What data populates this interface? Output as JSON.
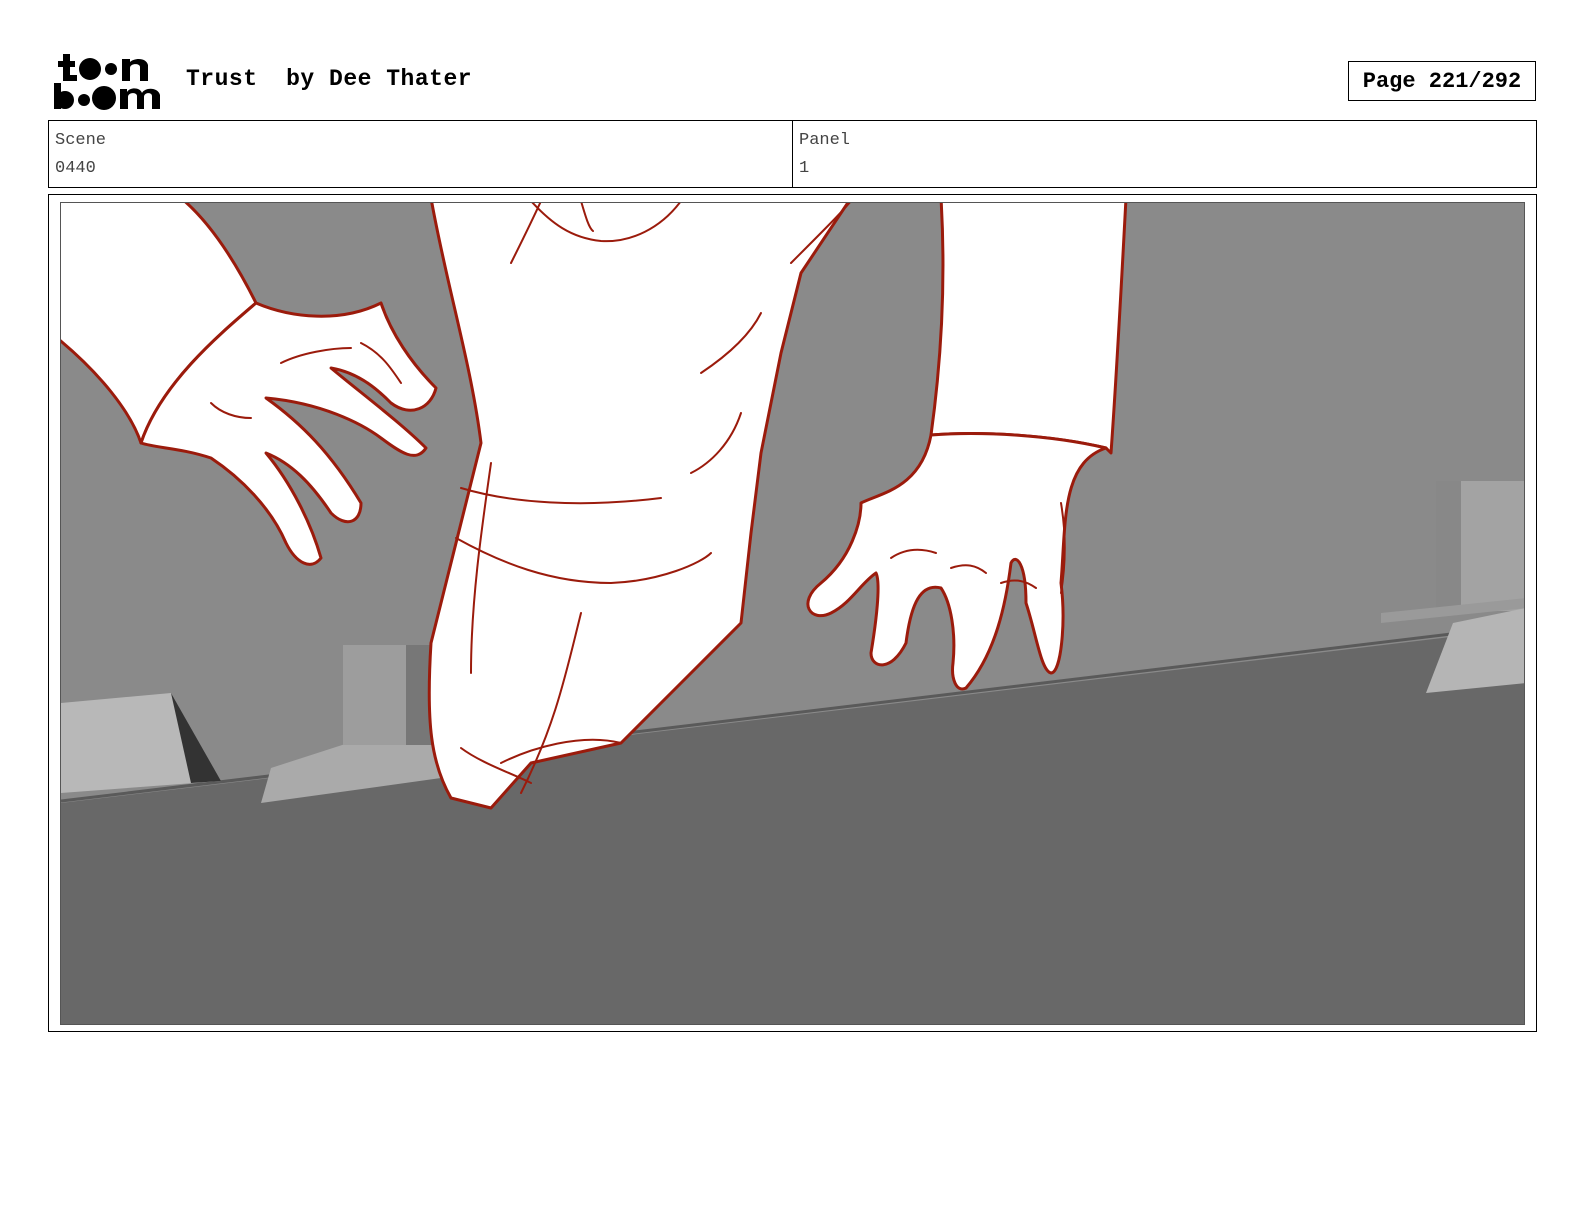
{
  "header": {
    "logo_text": "toon boom",
    "title": "Trust  by Dee Thater",
    "page": "Page 221/292"
  },
  "info": {
    "scene_label": "Scene",
    "scene_value": "0440",
    "panel_label": "Panel",
    "panel_value": "1"
  },
  "colors": {
    "sketch_line": "#9b1b0c",
    "wall": "#8a8a8a",
    "floor": "#686868",
    "block": "#b2b2b2"
  }
}
